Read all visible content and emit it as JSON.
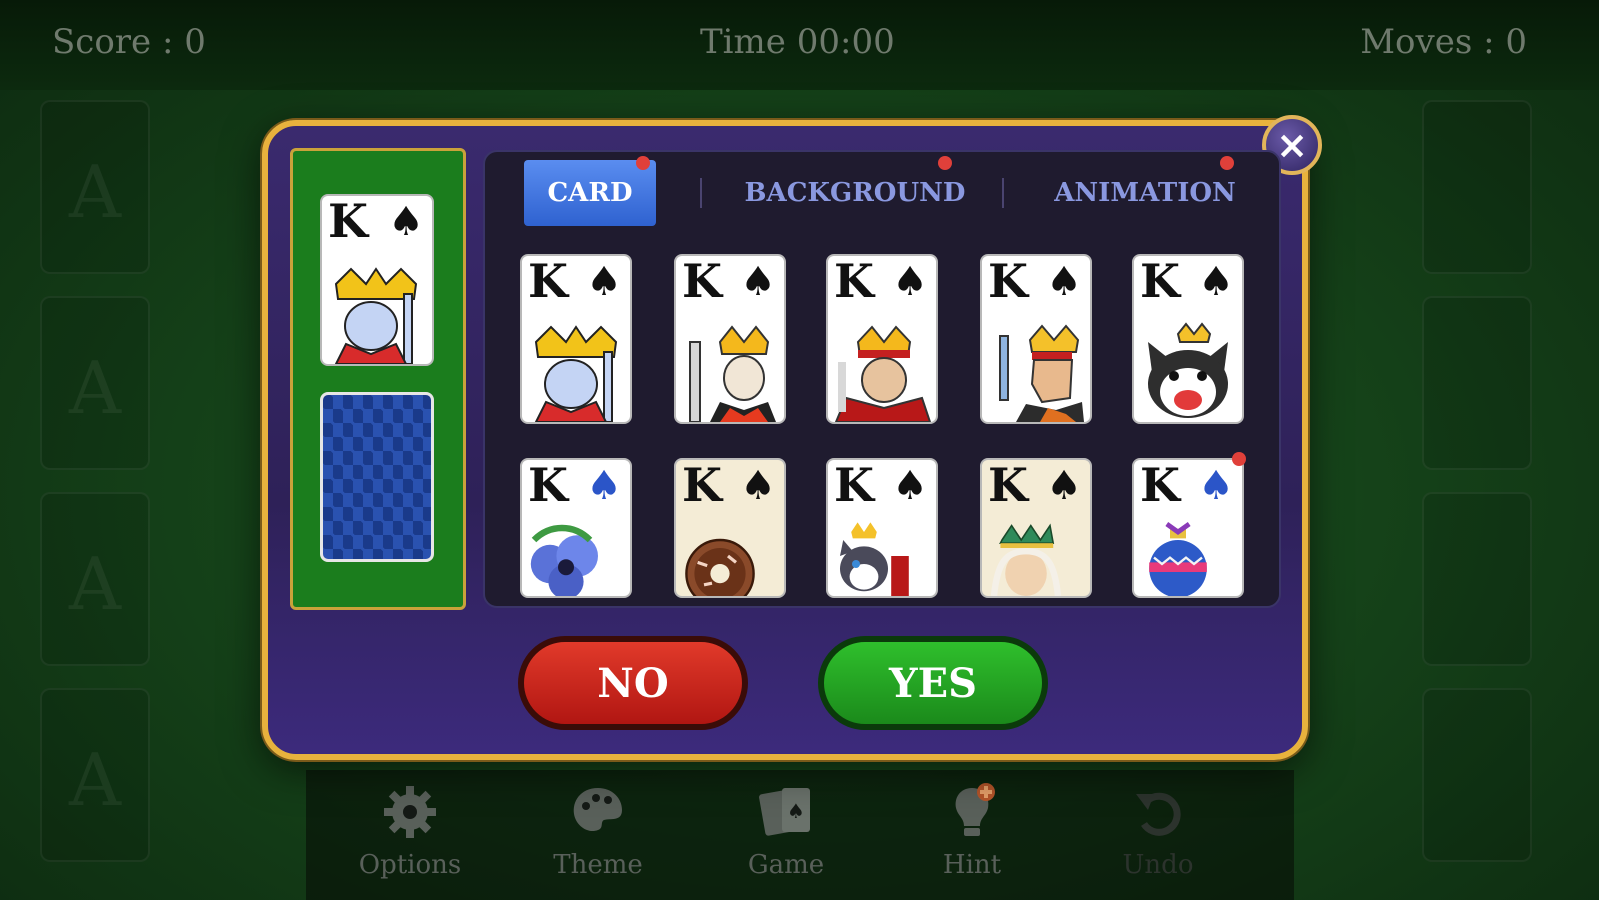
{
  "hud": {
    "score": "Score : 0",
    "time": "Time 00:00",
    "moves": "Moves : 0"
  },
  "foundation_placeholder": "A",
  "dialog": {
    "close_icon": "×",
    "tabs": [
      {
        "label": "CARD",
        "active": true,
        "badge": true
      },
      {
        "label": "BACKGROUND",
        "active": false,
        "badge": true
      },
      {
        "label": "ANIMATION",
        "active": false,
        "badge": true
      }
    ],
    "preview": {
      "rank": "K",
      "suit": "♠"
    },
    "card_designs": [
      {
        "rank": "K",
        "suit": "♠",
        "art": "classic-king"
      },
      {
        "rank": "K",
        "suit": "♠",
        "art": "king-sword"
      },
      {
        "rank": "K",
        "suit": "♠",
        "art": "king-red-robe"
      },
      {
        "rank": "K",
        "suit": "♠",
        "art": "king-profile"
      },
      {
        "rank": "K",
        "suit": "♠",
        "art": "bulldog-king"
      },
      {
        "rank": "K",
        "suit": "♠",
        "art": "blue-flower",
        "suit_color": "#2b55c8"
      },
      {
        "rank": "K",
        "suit": "♠",
        "art": "donut"
      },
      {
        "rank": "K",
        "suit": "♠",
        "art": "cat-king"
      },
      {
        "rank": "K",
        "suit": "♠",
        "art": "queen-crown"
      },
      {
        "rank": "K",
        "suit": "♠",
        "art": "christmas-ornament",
        "suit_color": "#2b55c8",
        "badge": true
      }
    ],
    "no_label": "NO",
    "yes_label": "YES"
  },
  "bottom_bar": [
    {
      "label": "Options",
      "icon": "gear-icon",
      "enabled": true
    },
    {
      "label": "Theme",
      "icon": "palette-icon",
      "enabled": true
    },
    {
      "label": "Game",
      "icon": "cards-icon",
      "enabled": true
    },
    {
      "label": "Hint",
      "icon": "lightbulb-icon",
      "enabled": true
    },
    {
      "label": "Undo",
      "icon": "undo-icon",
      "enabled": false
    }
  ],
  "colors": {
    "table_green": "#16451a",
    "dialog_purple": "#2e2158",
    "dialog_border": "#e8b23d",
    "tab_active": "#2f62d0",
    "no_red": "#c51f16",
    "yes_green": "#23a022",
    "badge_red": "#e0403a"
  }
}
